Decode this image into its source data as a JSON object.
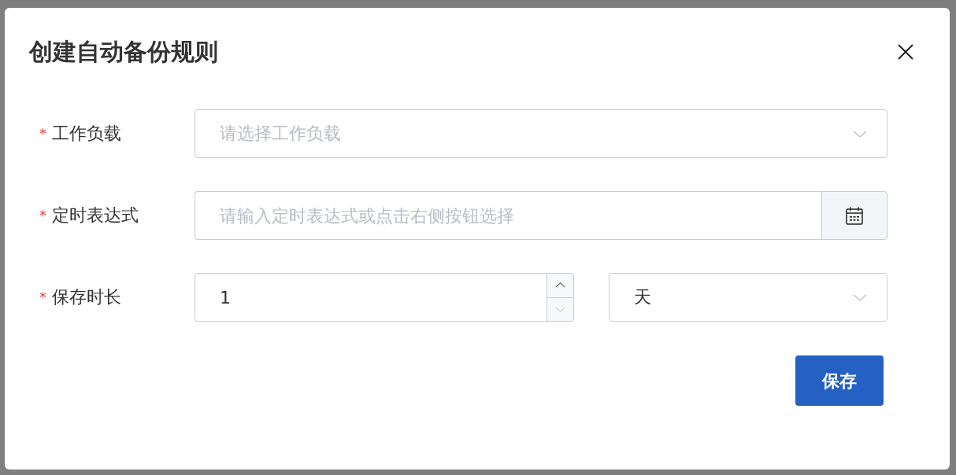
{
  "dialog": {
    "title": "创建自动备份规则"
  },
  "fields": [
    {
      "kind": "select",
      "required_mark": "*",
      "label": "工作负载",
      "placeholder": "请选择工作负载"
    },
    {
      "kind": "picker",
      "required_mark": "*",
      "label": "定时表达式",
      "placeholder": "请输入定时表达式或点击右侧按钮选择"
    },
    {
      "kind": "number_unit",
      "required_mark": "*",
      "label": "保存时长",
      "value": "1",
      "down_disabled": true,
      "unit": "天"
    }
  ],
  "buttons": [
    {
      "kind": "primary",
      "label": "保存"
    }
  ]
}
